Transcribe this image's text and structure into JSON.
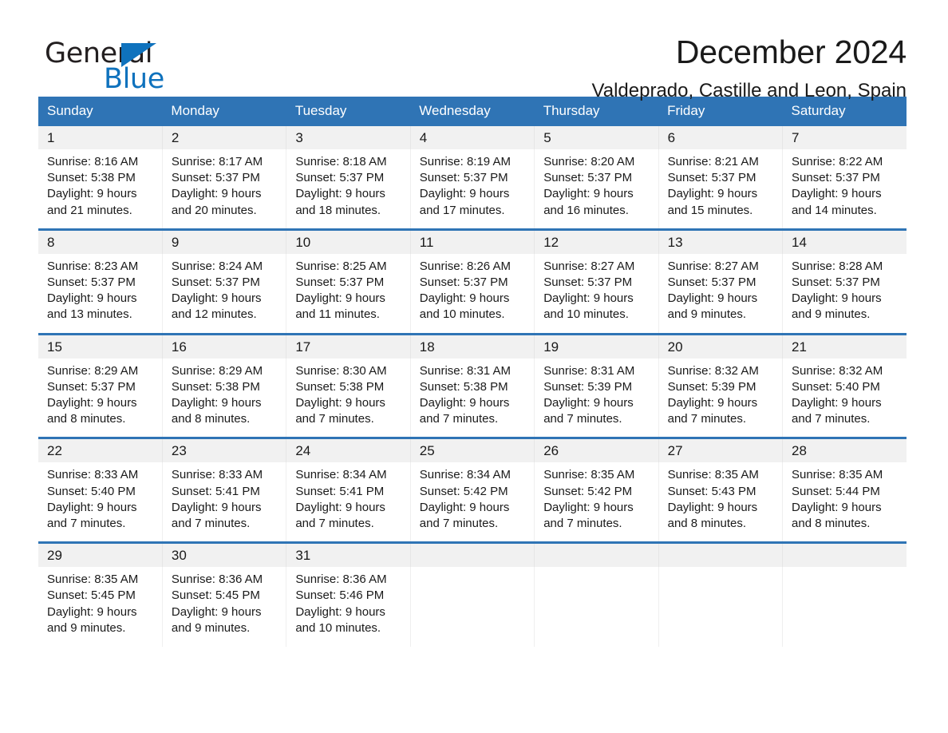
{
  "brand": {
    "name_part1": "General",
    "name_part2": "Blue",
    "triangle_color": "#0f72bd",
    "logo_icon": "triangle-logo-icon"
  },
  "header": {
    "title": "December 2024",
    "subtitle": "Valdeprado, Castille and Leon, Spain"
  },
  "colors": {
    "header_blue": "#2f74b5",
    "daynum_gray": "#f1f1f1",
    "week_separator": "#2f74b5",
    "text": "#1a1a1a"
  },
  "calendar": {
    "weekday_headers": [
      "Sunday",
      "Monday",
      "Tuesday",
      "Wednesday",
      "Thursday",
      "Friday",
      "Saturday"
    ],
    "weeks": [
      {
        "days": [
          {
            "num": "1",
            "sunrise": "Sunrise: 8:16 AM",
            "sunset": "Sunset: 5:38 PM",
            "daylight1": "Daylight: 9 hours",
            "daylight2": "and 21 minutes."
          },
          {
            "num": "2",
            "sunrise": "Sunrise: 8:17 AM",
            "sunset": "Sunset: 5:37 PM",
            "daylight1": "Daylight: 9 hours",
            "daylight2": "and 20 minutes."
          },
          {
            "num": "3",
            "sunrise": "Sunrise: 8:18 AM",
            "sunset": "Sunset: 5:37 PM",
            "daylight1": "Daylight: 9 hours",
            "daylight2": "and 18 minutes."
          },
          {
            "num": "4",
            "sunrise": "Sunrise: 8:19 AM",
            "sunset": "Sunset: 5:37 PM",
            "daylight1": "Daylight: 9 hours",
            "daylight2": "and 17 minutes."
          },
          {
            "num": "5",
            "sunrise": "Sunrise: 8:20 AM",
            "sunset": "Sunset: 5:37 PM",
            "daylight1": "Daylight: 9 hours",
            "daylight2": "and 16 minutes."
          },
          {
            "num": "6",
            "sunrise": "Sunrise: 8:21 AM",
            "sunset": "Sunset: 5:37 PM",
            "daylight1": "Daylight: 9 hours",
            "daylight2": "and 15 minutes."
          },
          {
            "num": "7",
            "sunrise": "Sunrise: 8:22 AM",
            "sunset": "Sunset: 5:37 PM",
            "daylight1": "Daylight: 9 hours",
            "daylight2": "and 14 minutes."
          }
        ]
      },
      {
        "days": [
          {
            "num": "8",
            "sunrise": "Sunrise: 8:23 AM",
            "sunset": "Sunset: 5:37 PM",
            "daylight1": "Daylight: 9 hours",
            "daylight2": "and 13 minutes."
          },
          {
            "num": "9",
            "sunrise": "Sunrise: 8:24 AM",
            "sunset": "Sunset: 5:37 PM",
            "daylight1": "Daylight: 9 hours",
            "daylight2": "and 12 minutes."
          },
          {
            "num": "10",
            "sunrise": "Sunrise: 8:25 AM",
            "sunset": "Sunset: 5:37 PM",
            "daylight1": "Daylight: 9 hours",
            "daylight2": "and 11 minutes."
          },
          {
            "num": "11",
            "sunrise": "Sunrise: 8:26 AM",
            "sunset": "Sunset: 5:37 PM",
            "daylight1": "Daylight: 9 hours",
            "daylight2": "and 10 minutes."
          },
          {
            "num": "12",
            "sunrise": "Sunrise: 8:27 AM",
            "sunset": "Sunset: 5:37 PM",
            "daylight1": "Daylight: 9 hours",
            "daylight2": "and 10 minutes."
          },
          {
            "num": "13",
            "sunrise": "Sunrise: 8:27 AM",
            "sunset": "Sunset: 5:37 PM",
            "daylight1": "Daylight: 9 hours",
            "daylight2": "and 9 minutes."
          },
          {
            "num": "14",
            "sunrise": "Sunrise: 8:28 AM",
            "sunset": "Sunset: 5:37 PM",
            "daylight1": "Daylight: 9 hours",
            "daylight2": "and 9 minutes."
          }
        ]
      },
      {
        "days": [
          {
            "num": "15",
            "sunrise": "Sunrise: 8:29 AM",
            "sunset": "Sunset: 5:37 PM",
            "daylight1": "Daylight: 9 hours",
            "daylight2": "and 8 minutes."
          },
          {
            "num": "16",
            "sunrise": "Sunrise: 8:29 AM",
            "sunset": "Sunset: 5:38 PM",
            "daylight1": "Daylight: 9 hours",
            "daylight2": "and 8 minutes."
          },
          {
            "num": "17",
            "sunrise": "Sunrise: 8:30 AM",
            "sunset": "Sunset: 5:38 PM",
            "daylight1": "Daylight: 9 hours",
            "daylight2": "and 7 minutes."
          },
          {
            "num": "18",
            "sunrise": "Sunrise: 8:31 AM",
            "sunset": "Sunset: 5:38 PM",
            "daylight1": "Daylight: 9 hours",
            "daylight2": "and 7 minutes."
          },
          {
            "num": "19",
            "sunrise": "Sunrise: 8:31 AM",
            "sunset": "Sunset: 5:39 PM",
            "daylight1": "Daylight: 9 hours",
            "daylight2": "and 7 minutes."
          },
          {
            "num": "20",
            "sunrise": "Sunrise: 8:32 AM",
            "sunset": "Sunset: 5:39 PM",
            "daylight1": "Daylight: 9 hours",
            "daylight2": "and 7 minutes."
          },
          {
            "num": "21",
            "sunrise": "Sunrise: 8:32 AM",
            "sunset": "Sunset: 5:40 PM",
            "daylight1": "Daylight: 9 hours",
            "daylight2": "and 7 minutes."
          }
        ]
      },
      {
        "days": [
          {
            "num": "22",
            "sunrise": "Sunrise: 8:33 AM",
            "sunset": "Sunset: 5:40 PM",
            "daylight1": "Daylight: 9 hours",
            "daylight2": "and 7 minutes."
          },
          {
            "num": "23",
            "sunrise": "Sunrise: 8:33 AM",
            "sunset": "Sunset: 5:41 PM",
            "daylight1": "Daylight: 9 hours",
            "daylight2": "and 7 minutes."
          },
          {
            "num": "24",
            "sunrise": "Sunrise: 8:34 AM",
            "sunset": "Sunset: 5:41 PM",
            "daylight1": "Daylight: 9 hours",
            "daylight2": "and 7 minutes."
          },
          {
            "num": "25",
            "sunrise": "Sunrise: 8:34 AM",
            "sunset": "Sunset: 5:42 PM",
            "daylight1": "Daylight: 9 hours",
            "daylight2": "and 7 minutes."
          },
          {
            "num": "26",
            "sunrise": "Sunrise: 8:35 AM",
            "sunset": "Sunset: 5:42 PM",
            "daylight1": "Daylight: 9 hours",
            "daylight2": "and 7 minutes."
          },
          {
            "num": "27",
            "sunrise": "Sunrise: 8:35 AM",
            "sunset": "Sunset: 5:43 PM",
            "daylight1": "Daylight: 9 hours",
            "daylight2": "and 8 minutes."
          },
          {
            "num": "28",
            "sunrise": "Sunrise: 8:35 AM",
            "sunset": "Sunset: 5:44 PM",
            "daylight1": "Daylight: 9 hours",
            "daylight2": "and 8 minutes."
          }
        ]
      },
      {
        "days": [
          {
            "num": "29",
            "sunrise": "Sunrise: 8:35 AM",
            "sunset": "Sunset: 5:45 PM",
            "daylight1": "Daylight: 9 hours",
            "daylight2": "and 9 minutes."
          },
          {
            "num": "30",
            "sunrise": "Sunrise: 8:36 AM",
            "sunset": "Sunset: 5:45 PM",
            "daylight1": "Daylight: 9 hours",
            "daylight2": "and 9 minutes."
          },
          {
            "num": "31",
            "sunrise": "Sunrise: 8:36 AM",
            "sunset": "Sunset: 5:46 PM",
            "daylight1": "Daylight: 9 hours",
            "daylight2": "and 10 minutes."
          },
          {
            "num": "",
            "sunrise": "",
            "sunset": "",
            "daylight1": "",
            "daylight2": ""
          },
          {
            "num": "",
            "sunrise": "",
            "sunset": "",
            "daylight1": "",
            "daylight2": ""
          },
          {
            "num": "",
            "sunrise": "",
            "sunset": "",
            "daylight1": "",
            "daylight2": ""
          },
          {
            "num": "",
            "sunrise": "",
            "sunset": "",
            "daylight1": "",
            "daylight2": ""
          }
        ]
      }
    ]
  }
}
